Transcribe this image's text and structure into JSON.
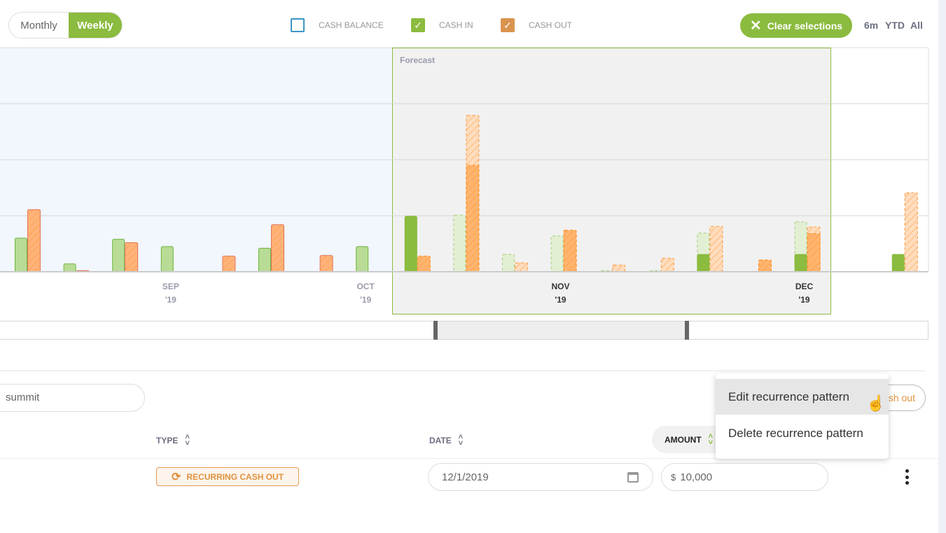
{
  "toggle": {
    "monthly": "Monthly",
    "weekly": "Weekly",
    "selected": "Weekly"
  },
  "legend": [
    {
      "label": "CASH BALANCE",
      "checked": false,
      "color": "#3a95c4"
    },
    {
      "label": "CASH IN",
      "checked": true,
      "color": "#8bbb3f"
    },
    {
      "label": "CASH OUT",
      "checked": true,
      "color": "#d9944e"
    }
  ],
  "clear_label": "Clear selections",
  "ranges": [
    "6m",
    "YTD",
    "All"
  ],
  "chart_data": {
    "type": "bar",
    "forecast_label": "Forecast",
    "x_ticks": [
      {
        "label": "SEP",
        "year": "'19",
        "week": 3.2
      },
      {
        "label": "OCT",
        "year": "'19",
        "week": 7.2
      },
      {
        "label": "NOV",
        "year": "'19",
        "week": 11.2
      },
      {
        "label": "DEC",
        "year": "'19",
        "week": 16.2
      }
    ],
    "forecast_weeks": [
      8,
      16
    ],
    "weeks": [
      {
        "phase": "history",
        "in": 0.6,
        "out": 1.11
      },
      {
        "phase": "history",
        "in": 0.14,
        "out": 0.02
      },
      {
        "phase": "history",
        "in": 0.58,
        "out": 0.52
      },
      {
        "phase": "history",
        "in": 0.45,
        "out": 0
      },
      {
        "phase": "history",
        "in": 0,
        "out": 0.28
      },
      {
        "phase": "history",
        "in": 0.42,
        "out": 0.84
      },
      {
        "phase": "history",
        "in": 0,
        "out": 0.29
      },
      {
        "phase": "history",
        "in": 0.45,
        "out": 0
      },
      {
        "phase": "forecast",
        "in_actual": 0.99,
        "in_forecast": 0.99,
        "out_actual": 0.28,
        "out_forecast": 0.12
      },
      {
        "phase": "forecast",
        "in_actual": 0,
        "in_forecast": 1.01,
        "out_actual": 1.9,
        "out_forecast": 2.79
      },
      {
        "phase": "forecast",
        "in_actual": 0,
        "in_forecast": 0.31,
        "out_actual": 0,
        "out_forecast": 0.16
      },
      {
        "phase": "forecast",
        "in_actual": 0,
        "in_forecast": 0.64,
        "out_actual": 0.74,
        "out_forecast": 0.74
      },
      {
        "phase": "forecast",
        "in_actual": 0,
        "in_forecast": 0.02,
        "out_actual": 0,
        "out_forecast": 0.12
      },
      {
        "phase": "forecast",
        "in_actual": 0,
        "in_forecast": 0.02,
        "out_actual": 0,
        "out_forecast": 0.24
      },
      {
        "phase": "forecast",
        "in_actual": 0.31,
        "in_forecast": 0.69,
        "out_actual": 0,
        "out_forecast": 0.81
      },
      {
        "phase": "forecast",
        "in_actual": 0,
        "in_forecast": 0,
        "out_actual": 0.21,
        "out_forecast": 0.21
      },
      {
        "phase": "forecast",
        "in_actual": 0.31,
        "in_forecast": 0.89,
        "out_actual": 0.68,
        "out_forecast": 0.8
      },
      {
        "phase": "future",
        "in_actual": 0,
        "in_forecast": 0,
        "out_actual": 0,
        "out_forecast": 0
      },
      {
        "phase": "future",
        "in_actual": 0.31,
        "in_forecast": 0.31,
        "out_actual": 0,
        "out_forecast": 1.41
      }
    ]
  },
  "search": {
    "value": "summit"
  },
  "cash_out_button": "Cash out",
  "table": {
    "headers": {
      "type": "TYPE",
      "date": "DATE",
      "amount": "AMOUNT"
    },
    "row": {
      "type": "RECURRING CASH OUT",
      "date": "12/1/2019",
      "currency": "$",
      "amount": "10,000"
    }
  },
  "menu": {
    "items": [
      "Edit recurrence pattern",
      "Delete recurrence pattern"
    ],
    "highlighted": 0
  }
}
